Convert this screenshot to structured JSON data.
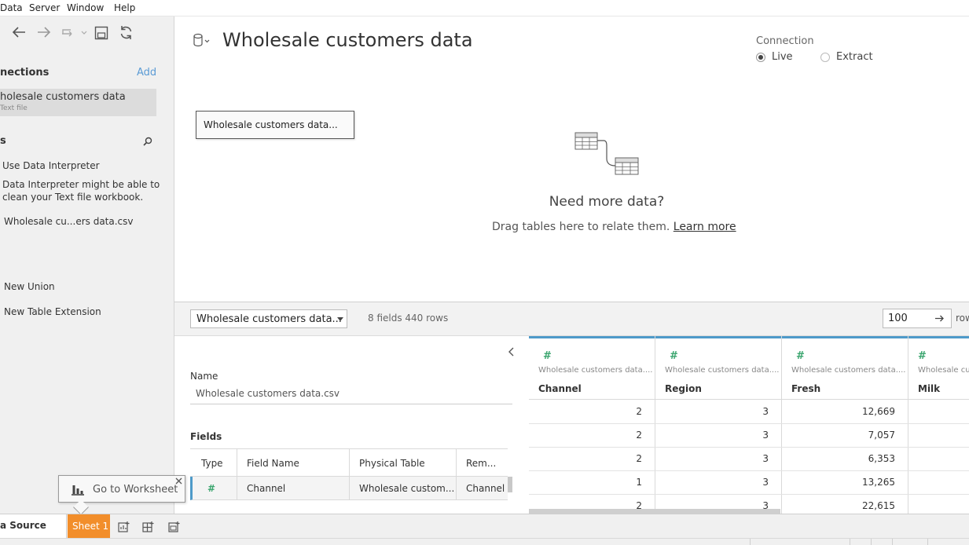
{
  "menubar": {
    "items": [
      "Data",
      "Server",
      "Window",
      "Help"
    ]
  },
  "sidebar": {
    "connections_title": "nections",
    "add_label": "Add",
    "connection": {
      "name": "holesale customers data",
      "type": "Text file"
    },
    "sheets_title": "s",
    "use_interpreter": "Use Data Interpreter",
    "interpreter_note_1": "Data Interpreter might be able to",
    "interpreter_note_2": "clean your Text file workbook.",
    "table_name": "Wholesale cu...ers data.csv",
    "new_union": "New Union",
    "new_extension": "New Table Extension"
  },
  "canvas": {
    "title": "Wholesale customers data",
    "connection_label": "Connection",
    "live_label": "Live",
    "extract_label": "Extract",
    "connection_mode": "Live",
    "table_box": "Wholesale customers data...",
    "need_more": "Need more data?",
    "drag_text": "Drag tables here to relate them.",
    "learn_more": "Learn more"
  },
  "midbar": {
    "table_select": "Wholesale customers data...",
    "fields_info": "8 fields 440 rows",
    "rows_value": "100",
    "rows_label": "rows"
  },
  "meta": {
    "name_label": "Name",
    "name_value": "Wholesale customers data.csv",
    "fields_label": "Fields",
    "headers": [
      "Type",
      "Field Name",
      "Physical Table",
      "Rem..."
    ],
    "row": {
      "type_icon": "#",
      "field_name": "Channel",
      "physical_table": "Wholesale custom...",
      "remote": "Channel"
    }
  },
  "grid": {
    "columns": [
      {
        "icon": "#",
        "table": "Wholesale customers data....",
        "name": "Channel",
        "values": [
          "2",
          "2",
          "2",
          "1",
          "2"
        ]
      },
      {
        "icon": "#",
        "table": "Wholesale customers data....",
        "name": "Region",
        "values": [
          "3",
          "3",
          "3",
          "3",
          "3"
        ]
      },
      {
        "icon": "#",
        "table": "Wholesale customers data....",
        "name": "Fresh",
        "values": [
          "12,669",
          "7,057",
          "6,353",
          "13,265",
          "22,615"
        ]
      },
      {
        "icon": "#",
        "table": "Wholesale cus",
        "name": "Milk",
        "values": [
          "",
          "",
          "",
          "",
          ""
        ]
      }
    ]
  },
  "tabs": {
    "data_source": "a Source",
    "sheet1": "Sheet 1"
  },
  "tooltip": {
    "label": "Go to Worksheet"
  },
  "colors": {
    "accent_orange": "#f28e2b",
    "column_accent": "#4e9ac9",
    "number_icon": "#3aa56e",
    "link": "#5b9bd5"
  }
}
